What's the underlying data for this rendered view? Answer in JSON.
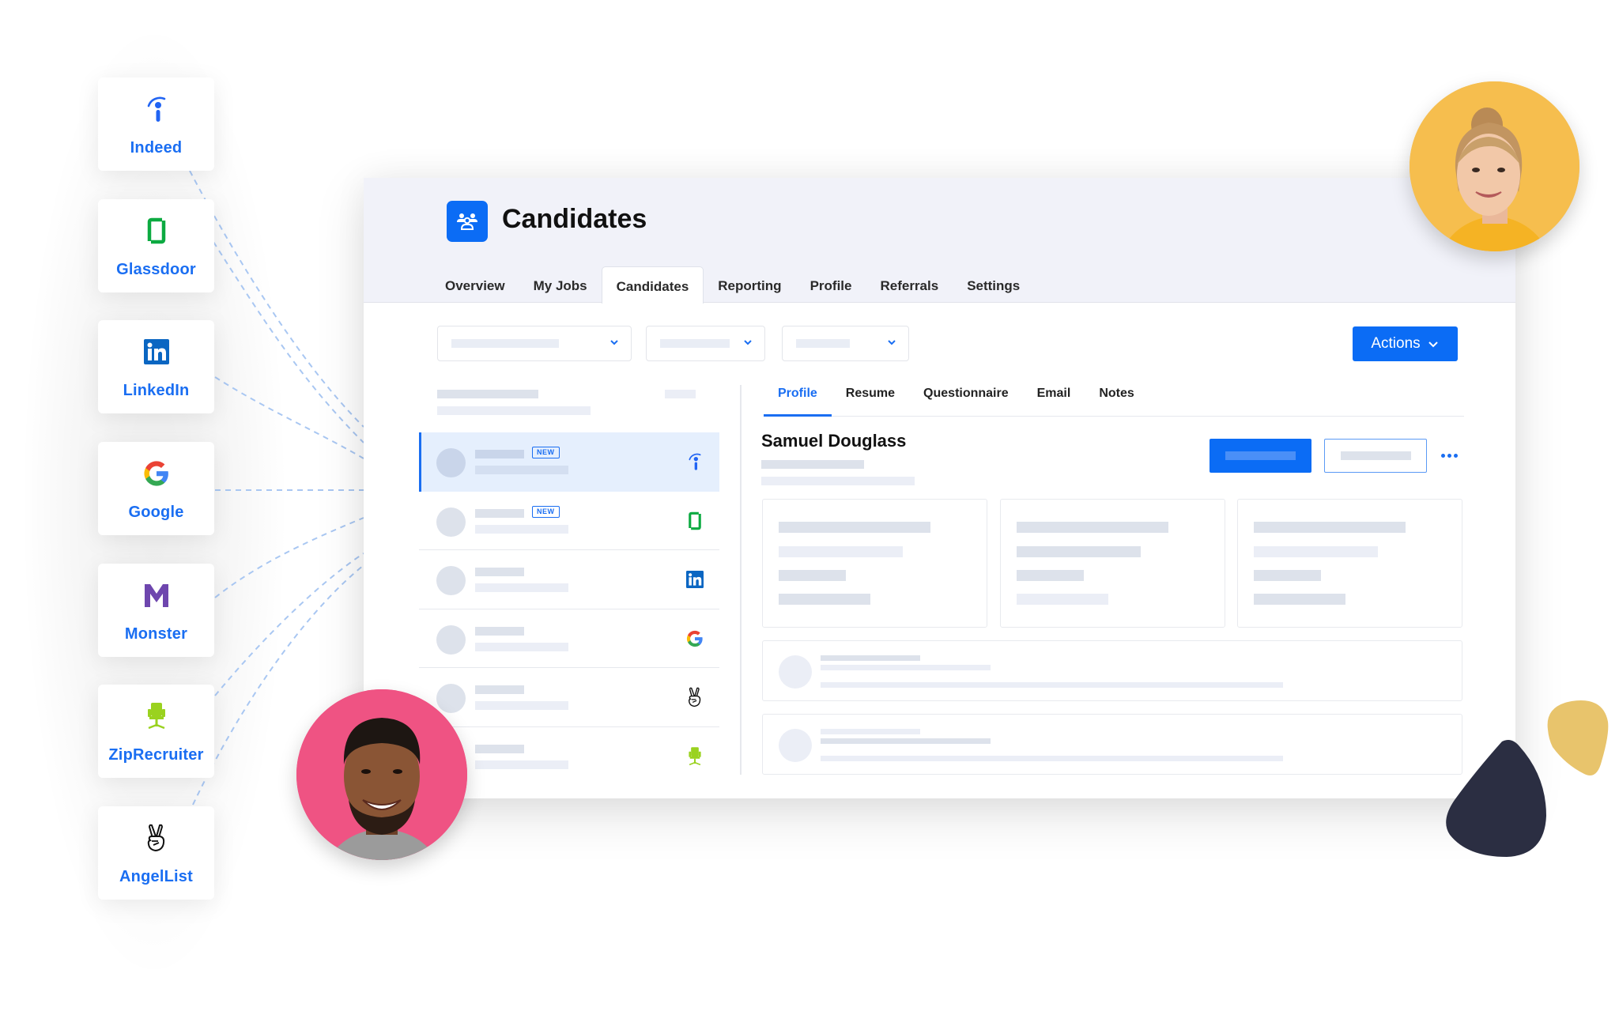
{
  "app": {
    "title": "Candidates",
    "icon": "people-group-icon",
    "accent_color": "#0b6cf5"
  },
  "main_tabs": [
    {
      "label": "Overview",
      "active": false
    },
    {
      "label": "My Jobs",
      "active": false
    },
    {
      "label": "Candidates",
      "active": true
    },
    {
      "label": "Reporting",
      "active": false
    },
    {
      "label": "Profile",
      "active": false
    },
    {
      "label": "Referrals",
      "active": false
    },
    {
      "label": "Settings",
      "active": false
    }
  ],
  "toolbar": {
    "actions_label": "Actions",
    "filters": [
      {
        "name": "filter-1",
        "value": ""
      },
      {
        "name": "filter-2",
        "value": ""
      },
      {
        "name": "filter-3",
        "value": ""
      }
    ]
  },
  "sources": [
    {
      "label": "Indeed",
      "icon": "indeed-icon",
      "color": "#2164f3"
    },
    {
      "label": "Glassdoor",
      "icon": "glassdoor-icon",
      "color": "#0caa41"
    },
    {
      "label": "LinkedIn",
      "icon": "linkedin-icon",
      "color": "#0a66c2"
    },
    {
      "label": "Google",
      "icon": "google-icon",
      "color": "#4285f4"
    },
    {
      "label": "Monster",
      "icon": "monster-icon",
      "color": "#6e46ae"
    },
    {
      "label": "ZipRecruiter",
      "icon": "ziprecruiter-icon",
      "color": "#9ad21f"
    },
    {
      "label": "AngelList",
      "icon": "angellist-icon",
      "color": "#111111"
    }
  ],
  "candidates": [
    {
      "badge": "NEW",
      "source": "indeed",
      "selected": true
    },
    {
      "badge": "NEW",
      "source": "glassdoor",
      "selected": false
    },
    {
      "badge": "",
      "source": "linkedin",
      "selected": false
    },
    {
      "badge": "",
      "source": "google",
      "selected": false
    },
    {
      "badge": "",
      "source": "angellist",
      "selected": false
    },
    {
      "badge": "",
      "source": "ziprecruiter",
      "selected": false
    }
  ],
  "detail": {
    "tabs": [
      {
        "label": "Profile",
        "active": true
      },
      {
        "label": "Resume",
        "active": false
      },
      {
        "label": "Questionnaire",
        "active": false
      },
      {
        "label": "Email",
        "active": false
      },
      {
        "label": "Notes",
        "active": false
      }
    ],
    "candidate_name": "Samuel Douglass"
  }
}
